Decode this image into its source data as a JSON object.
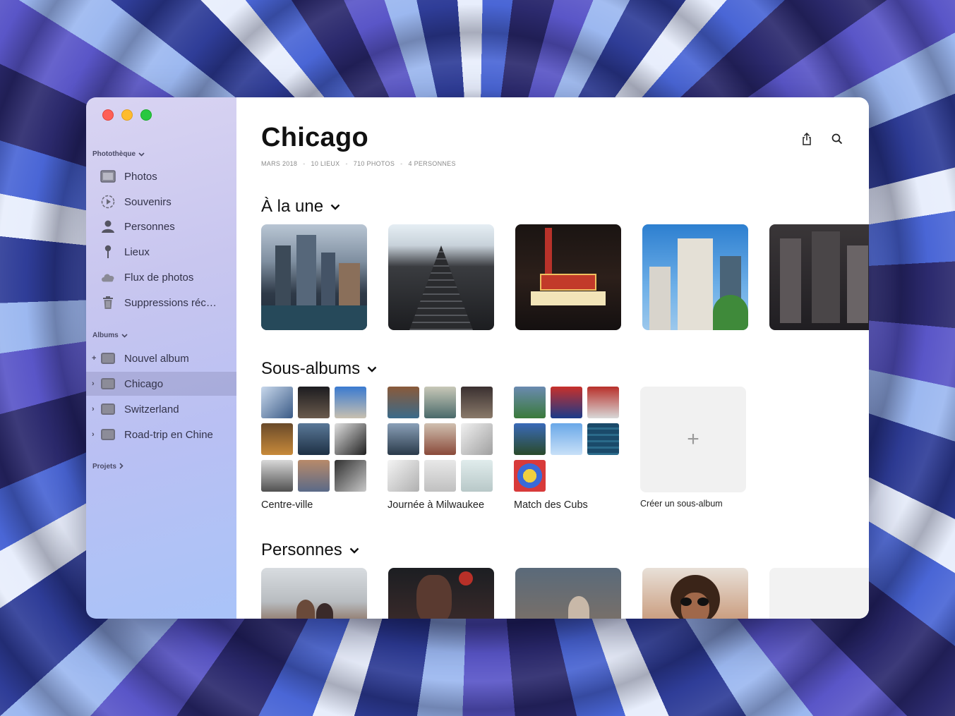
{
  "sidebar": {
    "library_header": "Photothèque",
    "library_items": [
      {
        "label": "Photos",
        "icon": "photos-icon"
      },
      {
        "label": "Souvenirs",
        "icon": "memories-icon"
      },
      {
        "label": "Personnes",
        "icon": "person-icon"
      },
      {
        "label": "Lieux",
        "icon": "pin-icon"
      },
      {
        "label": "Flux de photos",
        "icon": "cloud-icon"
      },
      {
        "label": "Suppressions réc…",
        "icon": "trash-icon"
      }
    ],
    "albums_header": "Albums",
    "album_items": [
      {
        "label": "Nouvel album",
        "disclosure": "+"
      },
      {
        "label": "Chicago",
        "disclosure": "›",
        "selected": true
      },
      {
        "label": "Switzerland",
        "disclosure": "›"
      },
      {
        "label": "Road-trip en Chine",
        "disclosure": "›"
      }
    ],
    "projects_header": "Projets"
  },
  "album": {
    "title": "Chicago",
    "meta": [
      "MARS 2018",
      "10 LIEUX",
      "710 PHOTOS",
      "4 PERSONNES"
    ],
    "meta_separator": "-"
  },
  "sections": {
    "featured": "À la une",
    "subalbums": "Sous-albums",
    "people": "Personnes"
  },
  "subalbums": [
    {
      "label": "Centre-ville"
    },
    {
      "label": "Journée à Milwaukee"
    },
    {
      "label": "Match des Cubs"
    }
  ],
  "create_subalbum": {
    "plus": "+",
    "label": "Créer un sous-album"
  },
  "icons": {
    "chevron": "chevron-down-icon",
    "share": "share-icon",
    "search": "search-icon"
  },
  "colors": {
    "close": "#fe5f57",
    "minimize": "#febc2e",
    "zoom": "#28c840"
  }
}
